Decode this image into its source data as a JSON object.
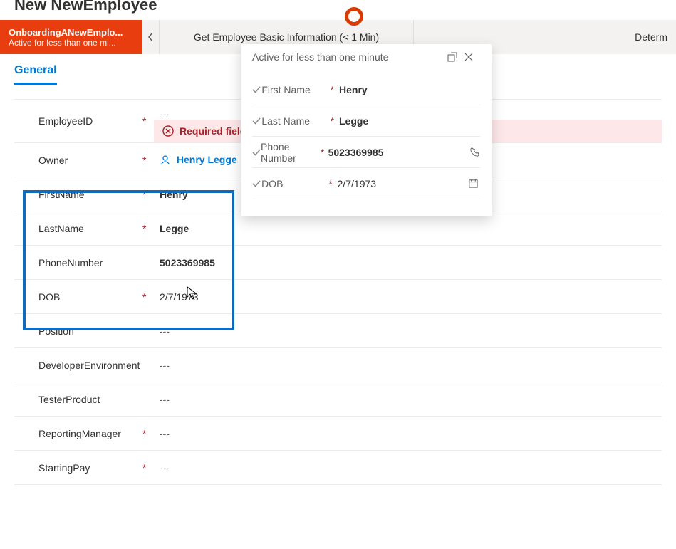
{
  "page_title": "New NewEmployee",
  "bpf": {
    "active_stage_name": "OnboardingANewEmplo...",
    "active_stage_sub": "Active for less than one mi...",
    "current_stage_label": "Get Employee Basic Information  (< 1 Min)",
    "next_stage_label": "Determ"
  },
  "tabs": {
    "general": "General"
  },
  "form": {
    "employee_id_label": "EmployeeID",
    "employee_id_value": "---",
    "error_text": "Required fields",
    "owner_label": "Owner",
    "owner_value": "Henry Legge",
    "first_name_label": "FirstName",
    "first_name_value": "Henry",
    "last_name_label": "LastName",
    "last_name_value": "Legge",
    "phone_label": "PhoneNumber",
    "phone_value": "5023369985",
    "dob_label": "DOB",
    "dob_value": "2/7/1973",
    "position_label": "Position",
    "position_value": "---",
    "devenv_label": "DeveloperEnvironment",
    "devenv_value": "---",
    "tester_label": "TesterProduct",
    "tester_value": "---",
    "manager_label": "ReportingManager",
    "manager_value": "---",
    "pay_label": "StartingPay",
    "pay_value": "---"
  },
  "flyout": {
    "header": "Active for less than one minute",
    "first_name_label": "First Name",
    "first_name_value": "Henry",
    "last_name_label": "Last Name",
    "last_name_value": "Legge",
    "phone_label": "Phone Number",
    "phone_value": "5023369985",
    "dob_label": "DOB",
    "dob_value": "2/7/1973"
  },
  "asterisk": "*"
}
